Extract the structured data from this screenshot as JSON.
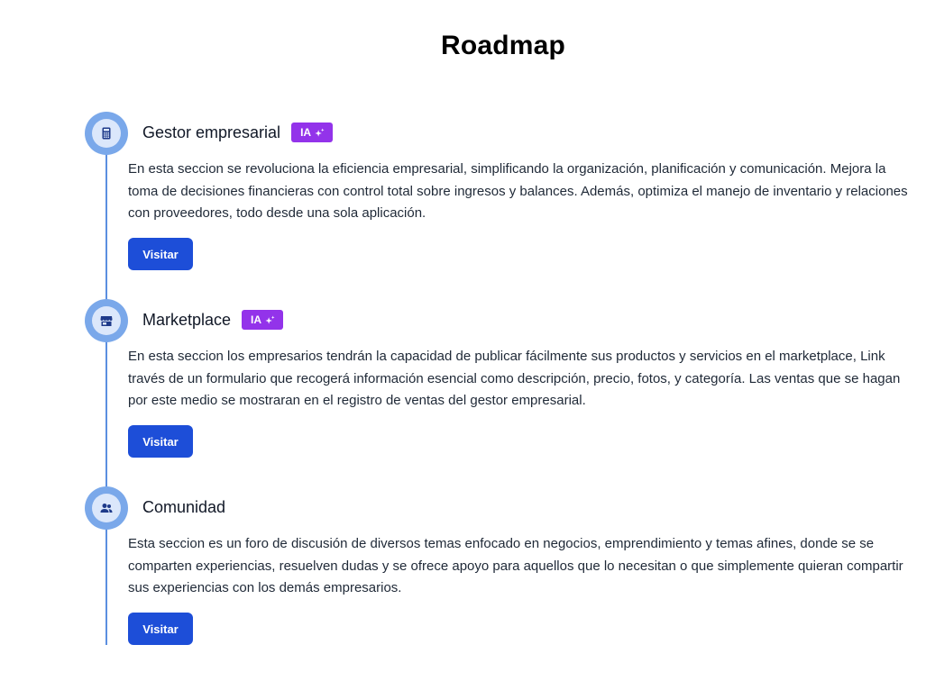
{
  "page": {
    "title": "Roadmap"
  },
  "colors": {
    "accent": "#1d4ed8",
    "badge": "#9333ea",
    "timeline": "#5b8fe0",
    "icon_ring": "#7aa8ea",
    "icon_bg": "#dbe7fb"
  },
  "items": [
    {
      "icon": "calculator-icon",
      "title": "Gestor empresarial",
      "badge": "IA",
      "badge_icon": "sparkles-icon",
      "description": "En esta seccion se revoluciona la eficiencia empresarial, simplificando la organización, planificación y comunicación. Mejora la toma de decisiones financieras con control total sobre ingresos y balances. Además, optimiza el manejo de inventario y relaciones con proveedores, todo desde una sola aplicación.",
      "button": "Visitar"
    },
    {
      "icon": "store-icon",
      "title": "Marketplace",
      "badge": "IA",
      "badge_icon": "sparkles-icon",
      "description": "En esta seccion los empresarios tendrán la capacidad de publicar fácilmente sus productos y servicios en el marketplace, Link través de un formulario que recogerá información esencial como descripción, precio, fotos, y categoría. Las ventas que se hagan por este medio se mostraran en el registro de ventas del gestor empresarial.",
      "button": "Visitar"
    },
    {
      "icon": "users-icon",
      "title": "Comunidad",
      "description": "Esta seccion es un foro de discusión de diversos temas enfocado en negocios, emprendimiento y temas afines, donde se se comparten experiencias, resuelven dudas y se ofrece apoyo para aquellos que lo necesitan o que simplemente quieran compartir sus experiencias con los demás empresarios.",
      "button": "Visitar"
    }
  ]
}
